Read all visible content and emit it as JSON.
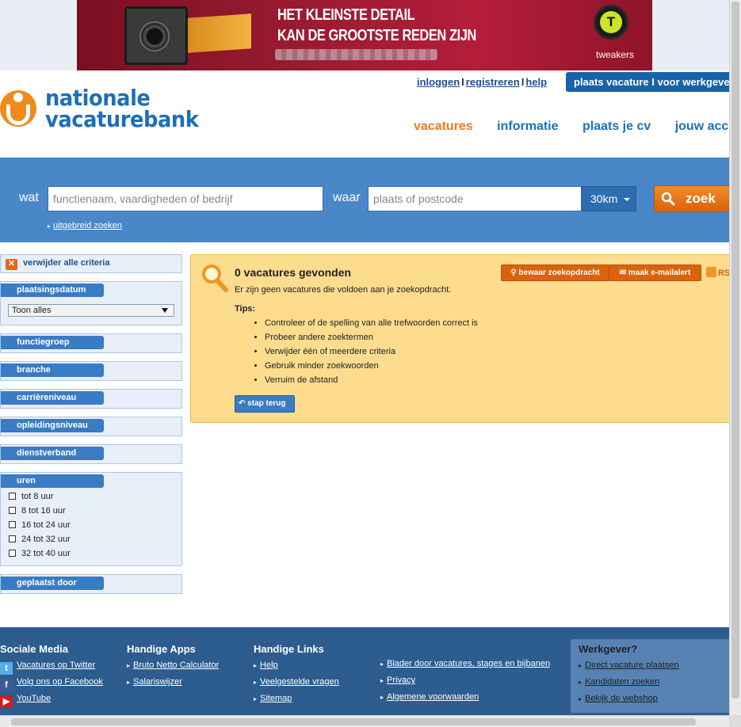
{
  "banner": {
    "line1": "HET KLEINSTE DETAIL",
    "line2": "KAN DE GROOTSTE REDEN ZIJN",
    "brand": "tweakers",
    "brand_glyph": "T"
  },
  "logo": {
    "line1": "nationale",
    "line2": "vacaturebank"
  },
  "toplinks": {
    "login": "inloggen",
    "register": "registreren",
    "help": "help",
    "separator": "I"
  },
  "plaats_button": "plaats vacature I voor werkgevers",
  "nav": [
    "vacatures",
    "informatie",
    "plaats je cv",
    "jouw account"
  ],
  "search": {
    "what_label": "wat",
    "what_placeholder": "functienaam, vaardigheden of bedrijf",
    "where_label": "waar",
    "where_placeholder": "plaats of postcode",
    "distance": "30km",
    "button": "zoek",
    "advanced": "uitgebreid zoeken"
  },
  "sidebar": {
    "remove_all": "verwijder alle criteria",
    "date": {
      "title": "plaatsingsdatum",
      "selected": "Toon alles"
    },
    "filters": [
      "functiegroep",
      "branche",
      "carrièreniveau",
      "opleidingsniveau",
      "dienstverband"
    ],
    "hours": {
      "title": "uren",
      "options": [
        "tot 8 uur",
        "8 tot 16 uur",
        "16 tot 24 uur",
        "24 tot 32 uur",
        "32 tot 40 uur"
      ]
    },
    "posted_by": "geplaatst door"
  },
  "results": {
    "title": "0 vacatures gevonden",
    "message": "Er zijn geen vacatures die voldoen aan je zoekopdracht.",
    "tips_label": "Tips:",
    "tips": [
      "Controleer of de spelling van alle trefwoorden correct is",
      "Probeer andere zoektermen",
      "Verwijder één of meerdere criteria",
      "Gebruik minder zoekwoorden",
      "Verruim de afstand"
    ],
    "back": "stap terug",
    "save_search": "bewaar zoekopdracht",
    "email_alert": "maak e-mailalert",
    "rss": "RSS"
  },
  "footer": {
    "social": {
      "title": "Sociale Media",
      "links": [
        "Vacatures op Twitter",
        "Volg ons op Facebook",
        "YouTube"
      ]
    },
    "apps": {
      "title": "Handige Apps",
      "links": [
        "Bruto Netto Calculator",
        "Salariswijzer"
      ]
    },
    "links": {
      "title": "Handige Links",
      "col1": [
        "Help",
        "Veelgestelde vragen",
        "Sitemap"
      ],
      "col2": [
        "Blader door vacatures, stages en bijbanen",
        "Privacy",
        "Algemene voorwaarden"
      ]
    },
    "employer": {
      "title": "Werkgever?",
      "links": [
        "Direct vacature plaatsen",
        "Kandidaten zoeken",
        "Bekijk de webshop"
      ]
    }
  },
  "colors": {
    "brand_blue": "#1d6fb8",
    "brand_orange": "#ef7b1f",
    "search_bg": "#4a87c8",
    "results_bg": "#fddc8e",
    "footer_bg": "#2d5c8f"
  }
}
